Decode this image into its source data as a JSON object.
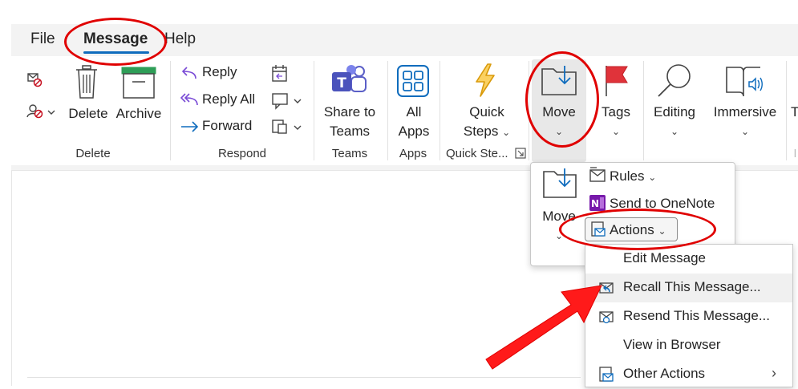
{
  "menu": {
    "tabs": [
      {
        "label": "File"
      },
      {
        "label": "Message"
      },
      {
        "label": "Help"
      }
    ]
  },
  "ribbon": {
    "delete_group": {
      "label": "Delete",
      "delete_button": "Delete",
      "archive_button": "Archive"
    },
    "respond_group": {
      "label": "Respond",
      "reply": "Reply",
      "reply_all": "Reply All",
      "forward": "Forward"
    },
    "teams_group": {
      "label": "Teams",
      "share_line1": "Share to",
      "share_line2": "Teams"
    },
    "apps_group": {
      "label": "Apps",
      "all_line1": "All",
      "all_line2": "Apps"
    },
    "quicksteps_group": {
      "label": "Quick Ste...",
      "qs_line1": "Quick",
      "qs_line2": "Steps"
    },
    "move_button": {
      "label": "Move"
    },
    "tags_button": {
      "label": "Tags"
    },
    "editing_button": {
      "label": "Editing"
    },
    "immersive_button": {
      "label": "Immersive"
    },
    "partial_next": "T",
    "partial_next_label": "I"
  },
  "move_dropdown": {
    "move_label": "Move",
    "rules": "Rules",
    "onenote": "Send to OneNote",
    "actions": "Actions"
  },
  "actions_submenu": {
    "items": [
      {
        "label": "Edit Message",
        "icon": "none"
      },
      {
        "label": "Recall This Message...",
        "icon": "recall-icon"
      },
      {
        "label": "Resend This Message...",
        "icon": "resend-icon"
      },
      {
        "label": "View in Browser",
        "icon": "none"
      },
      {
        "label": "Other Actions",
        "icon": "other-actions-icon",
        "has_submenu": true
      }
    ]
  },
  "colors": {
    "accent": "#0f6cbd",
    "annotation_red": "#e00000",
    "teams_purple": "#5b5fc7",
    "apps_blue": "#0f6cbd",
    "quicksteps_yellow": "#f2b01e",
    "tag_red": "#e0333a",
    "onenote_purple": "#7719aa"
  }
}
